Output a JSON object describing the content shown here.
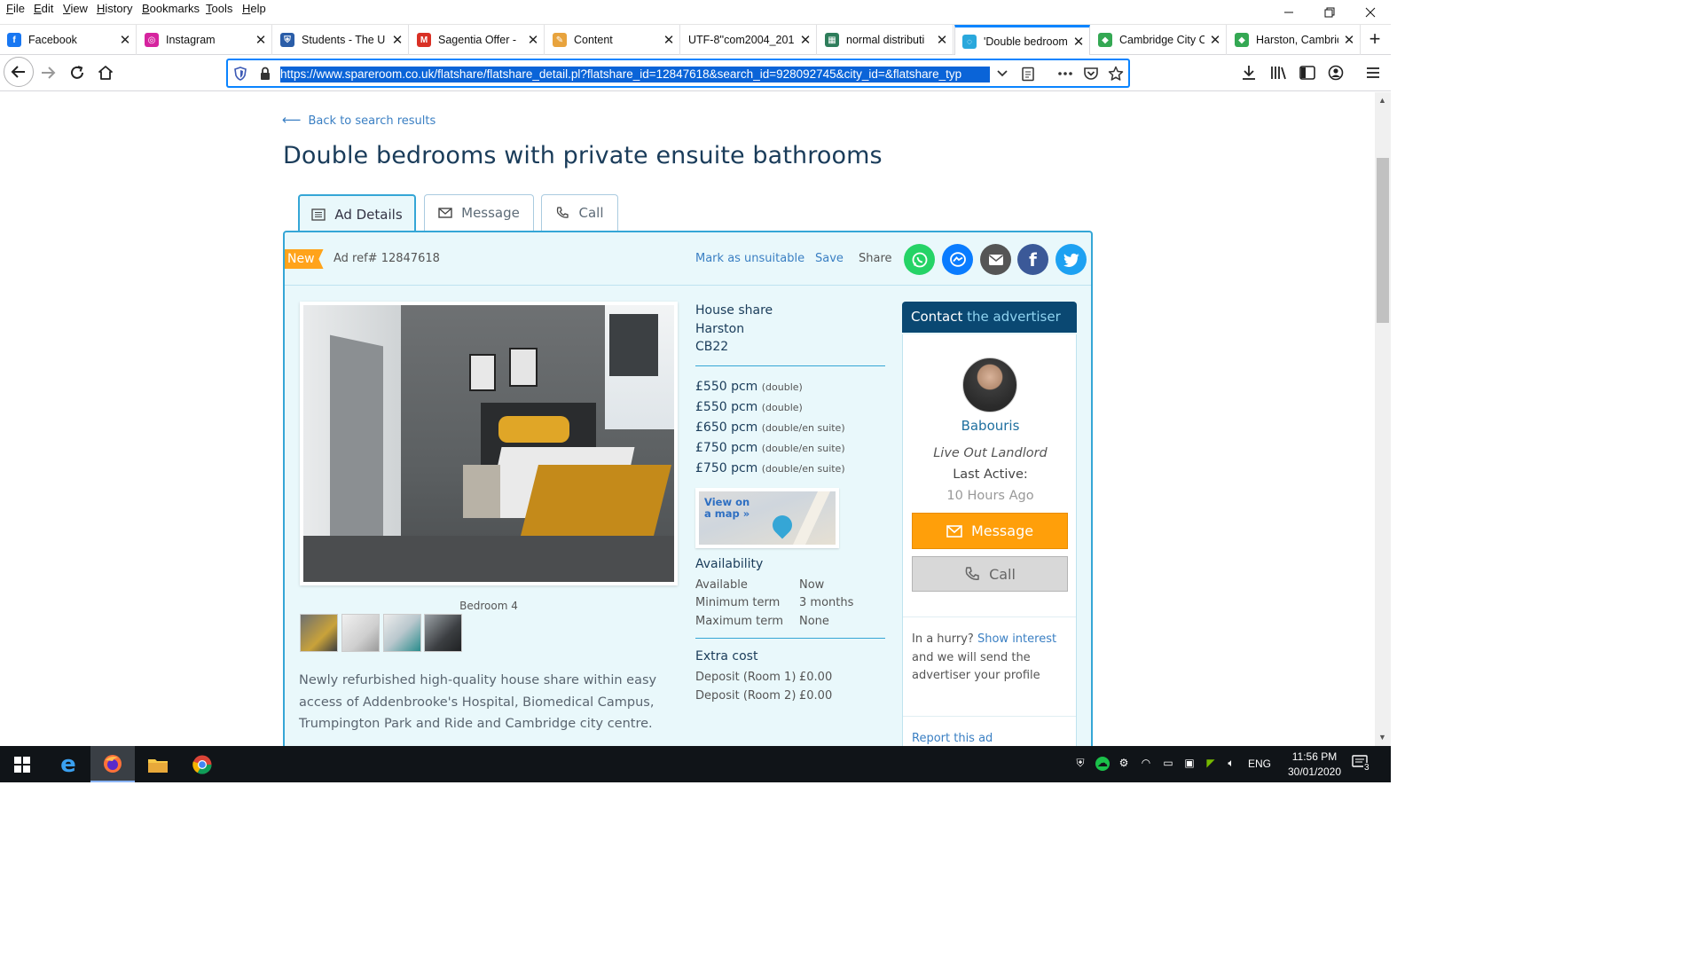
{
  "menubar": {
    "items": [
      "File",
      "Edit",
      "View",
      "History",
      "Bookmarks",
      "Tools",
      "Help"
    ]
  },
  "tabs": [
    {
      "label": "Facebook",
      "color": "#1877f2",
      "glyph": "f"
    },
    {
      "label": "Instagram",
      "color": "#d6249f",
      "glyph": "◎"
    },
    {
      "label": "Students - The U",
      "color": "#2a5da8",
      "glyph": "⛨"
    },
    {
      "label": "Sagentia Offer -",
      "color": "#d93025",
      "glyph": "M"
    },
    {
      "label": "Content",
      "color": "#e8a33d",
      "glyph": "✎"
    },
    {
      "label": "UTF-8''com2004_201",
      "color": "",
      "glyph": ""
    },
    {
      "label": "normal distributi",
      "color": "#2e7d5b",
      "glyph": "▦"
    },
    {
      "label": "'Double bedroom",
      "color": "#2aa8dc",
      "glyph": "◌"
    },
    {
      "label": "Cambridge City C",
      "color": "#34a853",
      "glyph": "◆"
    },
    {
      "label": "Harston, Cambrid",
      "color": "#34a853",
      "glyph": "◆"
    }
  ],
  "active_tab_index": 7,
  "address_bar": {
    "url": "https://www.spareroom.co.uk/flatshare/flatshare_detail.pl?flatshare_id=12847618&search_id=928092745&city_id=&flatshare_typ"
  },
  "page": {
    "back_link": "Back to search results",
    "title": "Double bedrooms with private ensuite bathrooms",
    "tabs": [
      "Ad Details",
      "Message",
      "Call"
    ],
    "badge": "New",
    "ad_ref": "Ad ref# 12847618",
    "mark_unsuitable": "Mark as unsuitable",
    "save": "Save",
    "share": "Share",
    "share_colors": {
      "whatsapp": "#25d366",
      "messenger": "#0a7cff",
      "email": "#555555",
      "facebook": "#3b5998",
      "twitter": "#1da1f2"
    },
    "photo_caption": "Bedroom 4",
    "description": "Newly refurbished high-quality house share within easy access of Addenbrooke's Hospital, Biomedical Campus, Trumpington Park and Ride and Cambridge city centre.",
    "address": [
      "House share",
      "Harston",
      "CB22"
    ],
    "prices": [
      {
        "amount": "£550 pcm",
        "type": "(double)"
      },
      {
        "amount": "£550 pcm",
        "type": "(double)"
      },
      {
        "amount": "£650 pcm",
        "type": "(double/en suite)"
      },
      {
        "amount": "£750 pcm",
        "type": "(double/en suite)"
      },
      {
        "amount": "£750 pcm",
        "type": "(double/en suite)"
      }
    ],
    "map_link": "View on a map »",
    "availability": {
      "heading": "Availability",
      "rows": [
        {
          "k": "Available",
          "v": "Now"
        },
        {
          "k": "Minimum term",
          "v": "3 months"
        },
        {
          "k": "Maximum term",
          "v": "None"
        }
      ]
    },
    "extra_cost": {
      "heading": "Extra cost",
      "rows": [
        {
          "k": "Deposit (Room 1)",
          "v": "£0.00"
        },
        {
          "k": "Deposit (Room 2)",
          "v": "£0.00"
        }
      ]
    },
    "contact": {
      "tab_strong": "Contact",
      "tab_light": "the advertiser",
      "name": "Babouris",
      "type": "Live Out Landlord",
      "last_active_label": "Last Active:",
      "last_active_value": "10 Hours Ago",
      "message_btn": "Message",
      "call_btn": "Call",
      "hurry_pre": "In a hurry?",
      "show_interest": "Show interest",
      "hurry_post": "and we will send the advertiser your profile",
      "report": "Report this ad"
    }
  },
  "taskbar": {
    "lang": "ENG",
    "time": "11:56 PM",
    "date": "30/01/2020",
    "notifications": "3"
  }
}
